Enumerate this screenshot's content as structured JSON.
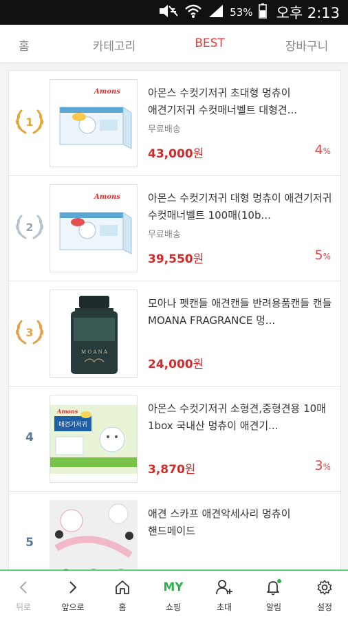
{
  "status_bar": {
    "battery_percent": "53%",
    "time": "오후 2:13"
  },
  "tabs": [
    {
      "label": "홈",
      "active": false
    },
    {
      "label": "카테고리",
      "active": false
    },
    {
      "label": "BEST",
      "active": true
    },
    {
      "label": "장바구니",
      "active": false
    }
  ],
  "products": [
    {
      "rank": "1",
      "rank_style": "gold-wreath",
      "title": "아몬스 수컷기저귀 초대형 멍츄이 애견기저귀 수컷매너벨트 대형견...",
      "shipping": "무료배송",
      "price": "43,000",
      "currency": "원",
      "discount": "4",
      "discount_unit": "%",
      "thumb_brand": "Amons"
    },
    {
      "rank": "2",
      "rank_style": "silver-wreath",
      "title": "아몬스 수컷기저귀 대형 멍츄이 애견기저귀 수컷매너벨트 100매(10b...",
      "shipping": "무료배송",
      "price": "39,550",
      "currency": "원",
      "discount": "5",
      "discount_unit": "%",
      "thumb_brand": "Amons"
    },
    {
      "rank": "3",
      "rank_style": "bronze-wreath",
      "title": "모아나 펫캔들 애견캔들 반려용품캔들 캔들 MOANA FRAGRANCE 멍...",
      "shipping": "",
      "price": "24,000",
      "currency": "원",
      "discount": "",
      "discount_unit": "",
      "thumb_brand": "MOANA"
    },
    {
      "rank": "4",
      "rank_style": "plain",
      "title": "아몬스 수컷기저귀 소형견,중형견용 10매 1box 국내산 멍츄이 애견기...",
      "shipping": "",
      "price": "3,870",
      "currency": "원",
      "discount": "3",
      "discount_unit": "%",
      "thumb_brand": "Amons",
      "thumb_label": "애견기저귀"
    },
    {
      "rank": "5",
      "rank_style": "plain",
      "title": "애견 스카프 애견악세사리 멍츄이 핸드메이드",
      "shipping": "",
      "price": "",
      "currency": "",
      "discount": "",
      "discount_unit": "",
      "thumb_brand": ""
    }
  ],
  "bottom_nav": [
    {
      "label": "뒤로",
      "icon": "chevron-left-icon",
      "disabled": true
    },
    {
      "label": "앞으로",
      "icon": "chevron-right-icon",
      "disabled": false
    },
    {
      "label": "홈",
      "icon": "home-icon",
      "disabled": false
    },
    {
      "label": "쇼핑",
      "icon": "my-shopping-icon",
      "icon_text": "MY",
      "disabled": false
    },
    {
      "label": "초대",
      "icon": "add-person-icon",
      "disabled": false
    },
    {
      "label": "알림",
      "icon": "bell-icon",
      "disabled": false
    },
    {
      "label": "설정",
      "icon": "gear-icon",
      "disabled": false
    }
  ],
  "colors": {
    "accent_red": "#ec3b3b",
    "price_red": "#d12a2a",
    "nav_green": "#5fd17a",
    "gold": "#e2a737",
    "silver": "#b8c2cc",
    "bronze": "#e4a04a"
  }
}
